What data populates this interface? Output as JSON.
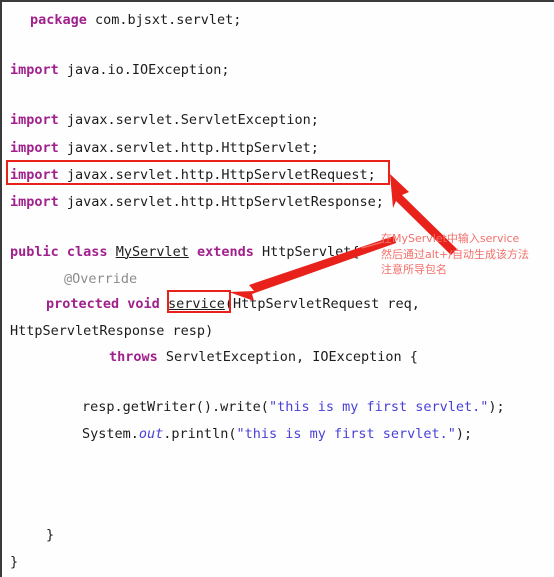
{
  "editor": {
    "language": "java",
    "colors": {
      "keyword": "#a0208c",
      "string": "#4a40d8",
      "annotation": "#8c8c8c",
      "plain": "#1c1c1c",
      "highlight_box": "#e8211a",
      "callout_text": "#f2706b",
      "background": "#fefefe"
    },
    "lines": {
      "l1_kw": "package",
      "l1_rest": " com.bjsxt.servlet;",
      "l3_kw": "import",
      "l3_rest": " java.io.IOException;",
      "l5_kw": "import",
      "l5_rest": " javax.servlet.ServletException;",
      "l6_kw": "import",
      "l6_rest": " javax.servlet.http.HttpServlet;",
      "l7_kw": "import",
      "l7_rest": " javax.servlet.http.HttpServletRequest;",
      "l8_kw": "import",
      "l8_rest": " javax.servlet.http.HttpServletResponse;",
      "l10_kw1": "public class",
      "l10_name": "MyServlet",
      "l10_kw2": "extends",
      "l10_tail": " HttpServlet{",
      "l11_override": "@Override",
      "l12_kw": "protected void",
      "l12_method": "service",
      "l12_tail": "(HttpServletRequest req,",
      "l13_text": "HttpServletResponse resp)",
      "l14_kw": "throws",
      "l14_tail": " ServletException, IOException {",
      "l16_pre": "resp.getWriter().write(",
      "l16_str": "\"this is my first servlet.\"",
      "l16_post": ");",
      "l17_pre": "System.",
      "l17_ital": "out",
      "l17_mid": ".println(",
      "l17_str": "\"this is my first servlet.\"",
      "l17_post": ");",
      "l20_brace": "}",
      "l21_brace": "}"
    }
  },
  "callout": {
    "line1": "在MyServlet中输入service",
    "line2": "然后通过alt+/自动生成该方法",
    "line3": "注意所导包名"
  },
  "highlights": {
    "import_box_label": "javax.servlet.http.HttpServletRequest;",
    "service_box_label": "service"
  }
}
